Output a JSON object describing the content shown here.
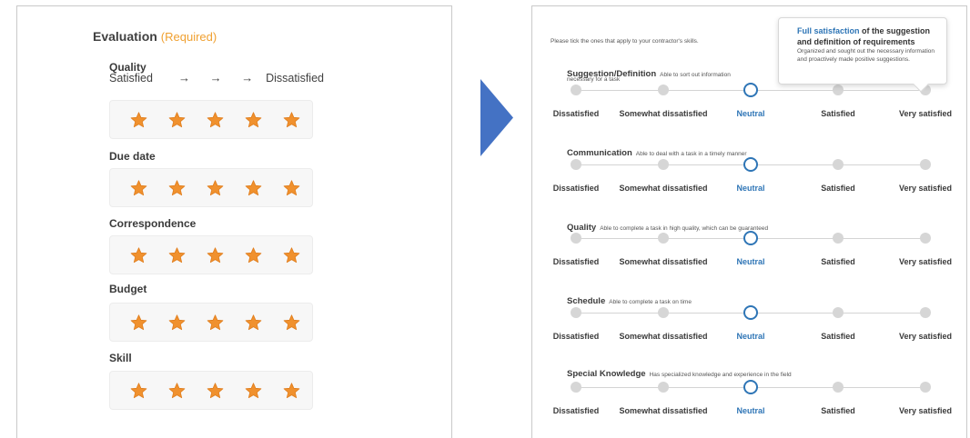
{
  "left": {
    "title": "Evaluation",
    "required": "(Required)",
    "scale": {
      "satisfied": "Satisfied",
      "arrows": "→ → →",
      "dissatisfied": "Dissatisfied"
    },
    "criteria": [
      {
        "label": "Quality",
        "rating": 5,
        "max": 5
      },
      {
        "label": "Due date",
        "rating": 5,
        "max": 5
      },
      {
        "label": "Correspondence",
        "rating": 5,
        "max": 5
      },
      {
        "label": "Budget",
        "rating": 5,
        "max": 5
      },
      {
        "label": "Skill",
        "rating": 5,
        "max": 5
      }
    ],
    "star_icon": "star-icon",
    "star_color": "#f0912e"
  },
  "arrow": {
    "icon": "arrow-right-icon",
    "color": "#4472c4"
  },
  "right": {
    "instruction": "Please tick the ones that apply to your contractor's skills.",
    "options": [
      "Dissatisfied",
      "Somewhat dissatisfied",
      "Neutral",
      "Satisfied",
      "Very satisfied"
    ],
    "selected_index": 2,
    "selected_color": "#2e75b6",
    "criteria": [
      {
        "name": "Suggestion/Definition",
        "desc": "Able to sort out information",
        "desc2": "necessary for a task"
      },
      {
        "name": "Communication",
        "desc": "Able to deal with a task in a timely manner"
      },
      {
        "name": "Quality",
        "desc": "Able to complete a task in high quality, which can be guaranteed"
      },
      {
        "name": "Schedule",
        "desc": "Able to complete a task on time"
      },
      {
        "name": "Special Knowledge",
        "desc": "Has specialized knowledge and experience in the field"
      }
    ],
    "tooltip": {
      "title_highlight": "Full satisfaction",
      "title_rest": " of the suggestion and definition of requirements",
      "body": "Organized and sought out the necessary information and proactively made positive suggestions."
    }
  }
}
